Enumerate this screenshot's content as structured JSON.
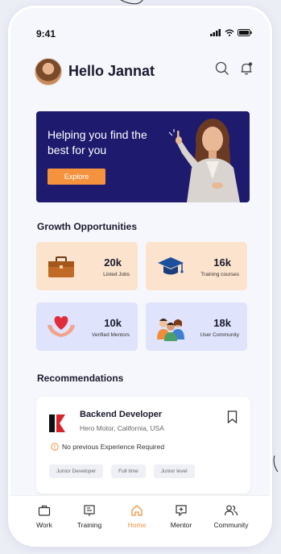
{
  "status_bar": {
    "time": "9:41"
  },
  "header": {
    "greeting": "Hello Jannat"
  },
  "banner": {
    "headline": "Helping you find the best for you",
    "button_label": "Explore"
  },
  "growth": {
    "title": "Growth Opportunities",
    "cards": [
      {
        "value": "20k",
        "label": "Listed Jobs",
        "icon": "briefcase-icon",
        "bg": "#fce3cd"
      },
      {
        "value": "16k",
        "label": "Training courses",
        "icon": "graduation-cap-icon",
        "bg": "#fce3cd"
      },
      {
        "value": "10k",
        "label": "Verified Mentors",
        "icon": "heart-hands-icon",
        "bg": "#dfe3fb"
      },
      {
        "value": "18k",
        "label": "User Community",
        "icon": "group-icon",
        "bg": "#dfe3fb"
      }
    ]
  },
  "recommendations": {
    "title": "Recommendations",
    "job": {
      "title": "Backend Developer",
      "company_location": "Hero Motor, California, USA",
      "requirement": "No previous Experience Required",
      "tags": [
        "Junior Developer",
        "Full time",
        "Junior level"
      ]
    }
  },
  "tabbar": {
    "tabs": [
      {
        "label": "Work",
        "icon": "briefcase-outline-icon"
      },
      {
        "label": "Training",
        "icon": "presentation-icon"
      },
      {
        "label": "Home",
        "icon": "home-icon"
      },
      {
        "label": "Mentor",
        "icon": "chat-plus-icon"
      },
      {
        "label": "Community",
        "icon": "users-icon"
      }
    ],
    "active": "Home"
  },
  "colors": {
    "accent": "#f5923e",
    "banner_bg": "#1e1b6e",
    "warm_card": "#fce3cd",
    "cool_card": "#dfe3fb"
  }
}
